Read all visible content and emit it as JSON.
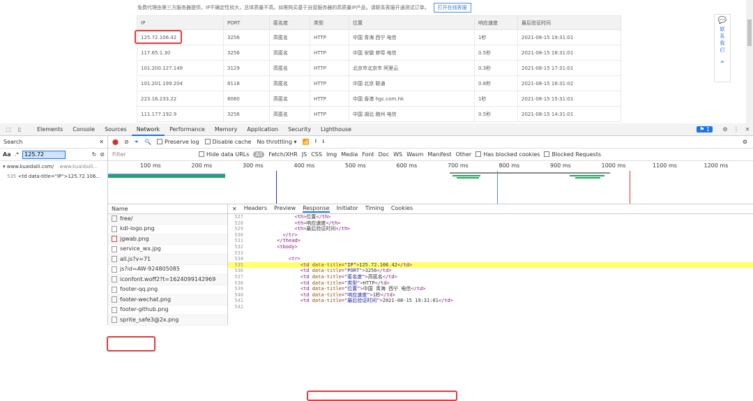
{
  "website": {
    "notice_text": "免费代理由第三方服务器提供，IP不确定性较大，总体质量不高。如需购买基于自营服务器的高质量IP产品，请联系客服开通测试订单。",
    "notice_button": "打开在线客服",
    "table": {
      "headers": [
        "IP",
        "PORT",
        "匿名度",
        "类型",
        "位置",
        "响应速度",
        "最后验证时间"
      ],
      "rows": [
        [
          "125.72.106.42",
          "3256",
          "高匿名",
          "HTTP",
          "中国 青海 西宁 电信",
          "1秒",
          "2021-08-15 19:31:01"
        ],
        [
          "117.65.1.30",
          "3256",
          "高匿名",
          "HTTP",
          "中国 安徽 蚌埠 电信",
          "0.5秒",
          "2021-08-15 18:31:01"
        ],
        [
          "101.200.127.149",
          "3129",
          "高匿名",
          "HTTP",
          "北京市北京市 阿里云",
          "0.3秒",
          "2021-08-15 17:31:01"
        ],
        [
          "101.201.199.204",
          "8118",
          "高匿名",
          "HTTP",
          "中国 北京 联通",
          "0.8秒",
          "2021-08-15 16:31:02"
        ],
        [
          "223.16.233.22",
          "8080",
          "高匿名",
          "HTTP",
          "中国 香港 hgc.com.hk",
          "1秒",
          "2021-08-15 15:31:01"
        ],
        [
          "111.177.192.9",
          "3256",
          "高匿名",
          "HTTP",
          "中国 湖北 随州 电信",
          "0.5秒",
          "2021-08-15 14:31:01"
        ]
      ]
    },
    "float_panel": {
      "label": [
        "联",
        "系",
        "我",
        "们"
      ]
    }
  },
  "devtools": {
    "tabs": [
      "Elements",
      "Console",
      "Sources",
      "Network",
      "Performance",
      "Memory",
      "Application",
      "Security",
      "Lighthouse"
    ],
    "active_tab": "Network",
    "issues_badge": "1",
    "search": {
      "title": "Search",
      "case_label": "Aa",
      "regex_label": ".*",
      "query": "125.72",
      "result_file": "▾ www.kuaidaili.com/",
      "result_file_url": "www.kuaidaili...",
      "result_line_no": "535",
      "result_line": "<td data-title=\"IP\">125.72.106..."
    },
    "toolbar": {
      "preserve_log": "Preserve log",
      "disable_cache": "Disable cache",
      "throttling": "No throttling"
    },
    "filter": {
      "placeholder": "Filter",
      "hide_data_urls": "Hide data URLs",
      "types": [
        "All",
        "Fetch/XHR",
        "JS",
        "CSS",
        "Img",
        "Media",
        "Font",
        "Doc",
        "WS",
        "Wasm",
        "Manifest",
        "Other"
      ],
      "has_blocked_cookies": "Has blocked cookies",
      "blocked_requests": "Blocked Requests"
    },
    "timeline_ticks": [
      "100 ms",
      "200 ms",
      "300 ms",
      "400 ms",
      "500 ms",
      "600 ms",
      "700 ms",
      "800 ms",
      "900 ms",
      "1000 ms",
      "1100 ms",
      "1200 ms"
    ],
    "network_list": {
      "header": "Name",
      "items": [
        "free/",
        "kdl-logo.png",
        "jgwab.png",
        "service_wx.jpg",
        "all.js?v=71",
        "js?id=AW-924805085",
        "iconfont.woff2?t=1624099142969",
        "footer-qq.png",
        "footer-wechat.png",
        "footer-github.png",
        "sprite_safe3@2x.png"
      ]
    },
    "detail_tabs": [
      "Headers",
      "Preview",
      "Response",
      "Initiator",
      "Timing",
      "Cookies"
    ],
    "active_detail_tab": "Response",
    "code_lines": [
      {
        "n": "527",
        "indent": "                ",
        "parts": [
          [
            "tag",
            "<th>"
          ],
          [
            "txt",
            "位置"
          ],
          [
            "tag",
            "</th>"
          ]
        ]
      },
      {
        "n": "528",
        "indent": "                ",
        "parts": [
          [
            "tag",
            "<th>"
          ],
          [
            "txt",
            "响应速度"
          ],
          [
            "tag",
            "</th>"
          ]
        ]
      },
      {
        "n": "529",
        "indent": "                ",
        "parts": [
          [
            "tag",
            "<th>"
          ],
          [
            "txt",
            "最后验证时间"
          ],
          [
            "tag",
            "</th>"
          ]
        ]
      },
      {
        "n": "530",
        "indent": "            ",
        "parts": [
          [
            "tag",
            "</tr>"
          ]
        ]
      },
      {
        "n": "531",
        "indent": "          ",
        "parts": [
          [
            "tag",
            "</thead>"
          ]
        ]
      },
      {
        "n": "532",
        "indent": "          ",
        "parts": [
          [
            "tag",
            "<tbody>"
          ]
        ]
      },
      {
        "n": "533",
        "indent": "",
        "parts": []
      },
      {
        "n": "534",
        "indent": "              ",
        "parts": [
          [
            "tag",
            "<tr>"
          ]
        ]
      },
      {
        "n": "535",
        "indent": "                  ",
        "parts": [
          [
            "tag",
            "<td "
          ],
          [
            "an",
            "data-title"
          ],
          [
            "tag",
            "="
          ],
          [
            "av",
            "\"IP\""
          ],
          [
            "tag",
            ">"
          ],
          [
            "txt",
            "125.72.106.42"
          ],
          [
            "tag",
            "</td>"
          ]
        ],
        "highlight": true
      },
      {
        "n": "536",
        "indent": "                  ",
        "parts": [
          [
            "tag",
            "<td "
          ],
          [
            "an",
            "data-title"
          ],
          [
            "tag",
            "="
          ],
          [
            "av",
            "\"PORT\""
          ],
          [
            "tag",
            ">"
          ],
          [
            "txt",
            "3256"
          ],
          [
            "tag",
            "</td>"
          ]
        ]
      },
      {
        "n": "537",
        "indent": "                  ",
        "parts": [
          [
            "tag",
            "<td "
          ],
          [
            "an",
            "data-title"
          ],
          [
            "tag",
            "="
          ],
          [
            "av",
            "\"匿名度\""
          ],
          [
            "tag",
            ">"
          ],
          [
            "txt",
            "高匿名"
          ],
          [
            "tag",
            "</td>"
          ]
        ]
      },
      {
        "n": "538",
        "indent": "                  ",
        "parts": [
          [
            "tag",
            "<td "
          ],
          [
            "an",
            "data-title"
          ],
          [
            "tag",
            "="
          ],
          [
            "av",
            "\"类型\""
          ],
          [
            "tag",
            ">"
          ],
          [
            "txt",
            "HTTP"
          ],
          [
            "tag",
            "</td>"
          ]
        ]
      },
      {
        "n": "539",
        "indent": "                  ",
        "parts": [
          [
            "tag",
            "<td "
          ],
          [
            "an",
            "data-title"
          ],
          [
            "tag",
            "="
          ],
          [
            "av",
            "\"位置\""
          ],
          [
            "tag",
            ">"
          ],
          [
            "txt",
            "中国 青海 西宁 电信"
          ],
          [
            "tag",
            "</td>"
          ]
        ]
      },
      {
        "n": "540",
        "indent": "                  ",
        "parts": [
          [
            "tag",
            "<td "
          ],
          [
            "an",
            "data-title"
          ],
          [
            "tag",
            "="
          ],
          [
            "av",
            "\"响应速度\""
          ],
          [
            "tag",
            ">"
          ],
          [
            "txt",
            "1秒"
          ],
          [
            "tag",
            "</td>"
          ]
        ]
      },
      {
        "n": "541",
        "indent": "                  ",
        "parts": [
          [
            "tag",
            "<td "
          ],
          [
            "an",
            "data-title"
          ],
          [
            "tag",
            "="
          ],
          [
            "av",
            "\"最后验证时间\""
          ],
          [
            "tag",
            ">"
          ],
          [
            "txt",
            "2021-08-15 19:31:01"
          ],
          [
            "tag",
            "</td>"
          ]
        ]
      },
      {
        "n": "542",
        "indent": "",
        "parts": []
      }
    ]
  }
}
